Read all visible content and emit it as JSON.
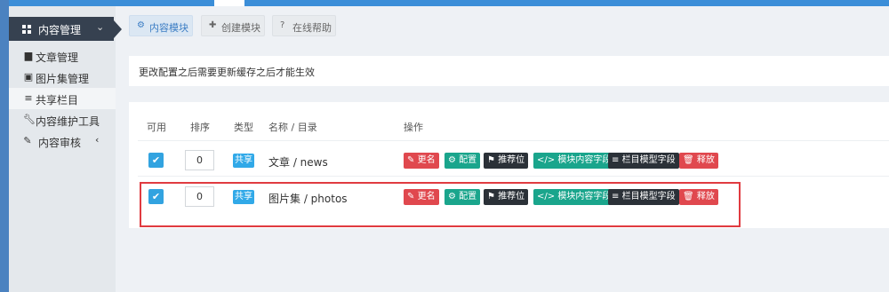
{
  "sidebar": {
    "header_label": "内容管理",
    "items": [
      {
        "label": "文章管理",
        "icon": "file-icon"
      },
      {
        "label": "图片集管理",
        "icon": "image-icon"
      },
      {
        "label": "共享栏目",
        "icon": "list-icon"
      },
      {
        "label": "内容维护工具",
        "icon": "wrench-icon"
      },
      {
        "label": "内容审核",
        "icon": "edit-icon"
      }
    ]
  },
  "tabs": [
    {
      "label": "内容模块",
      "icon": "cogs-icon"
    },
    {
      "label": "创建模块",
      "icon": "plus-icon"
    },
    {
      "label": "在线帮助",
      "icon": "question-icon"
    }
  ],
  "notice": "更改配置之后需要更新缓存之后才能生效",
  "table": {
    "headers": [
      "可用",
      "排序",
      "类型",
      "名称 / 目录",
      "操作"
    ],
    "rows": [
      {
        "order": "0",
        "type": "共享",
        "name": "文章 / news"
      },
      {
        "order": "0",
        "type": "共享",
        "name": "图片集 / photos"
      }
    ],
    "actions": [
      "更名",
      "配置",
      "推荐位",
      "模块内容字段",
      "栏目模型字段",
      "释放"
    ]
  },
  "colors": {
    "accent": "#3b8ed8",
    "sidebar_dark": "#364150",
    "danger": "#e0484e",
    "success": "#1aa58c",
    "dark_button": "#2b3138",
    "badge": "#31a9e8"
  }
}
